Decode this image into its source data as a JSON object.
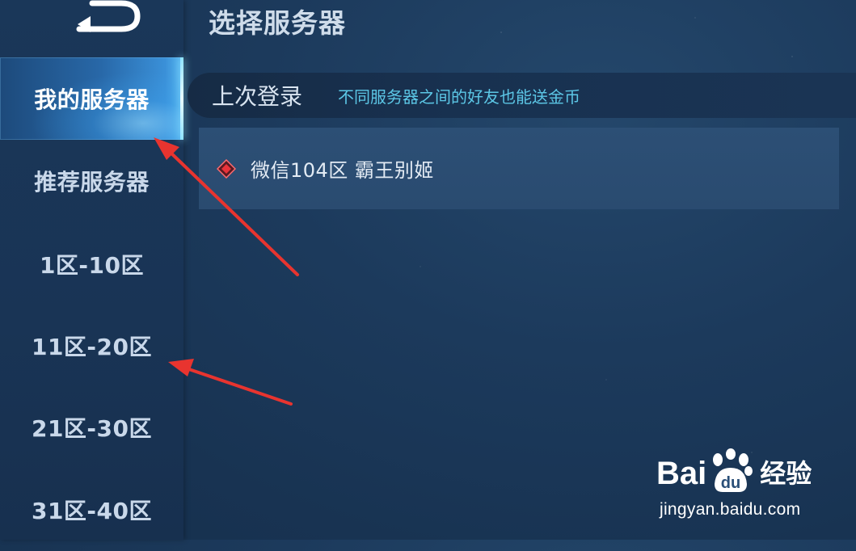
{
  "header": {
    "title": "选择服务器"
  },
  "sidebar": {
    "items": [
      {
        "label": "我的服务器",
        "active": true
      },
      {
        "label": "推荐服务器"
      },
      {
        "label": "1区-10区"
      },
      {
        "label": "11区-20区"
      },
      {
        "label": "21区-30区"
      },
      {
        "label": "31区-40区"
      }
    ]
  },
  "main": {
    "last_login_label": "上次登录",
    "hint": "不同服务器之间的好友也能送金币",
    "servers": [
      {
        "name": "微信104区 霸王别姬",
        "status_color": "#e8333a"
      }
    ]
  },
  "watermark": {
    "brand_a": "Bai",
    "brand_b": "du",
    "brand_c": "经验",
    "url": "jingyan.baidu.com"
  },
  "colors": {
    "accent": "#5cc7e6",
    "active_tab": "#3a90d8",
    "annotation_arrow": "#e8342f"
  }
}
